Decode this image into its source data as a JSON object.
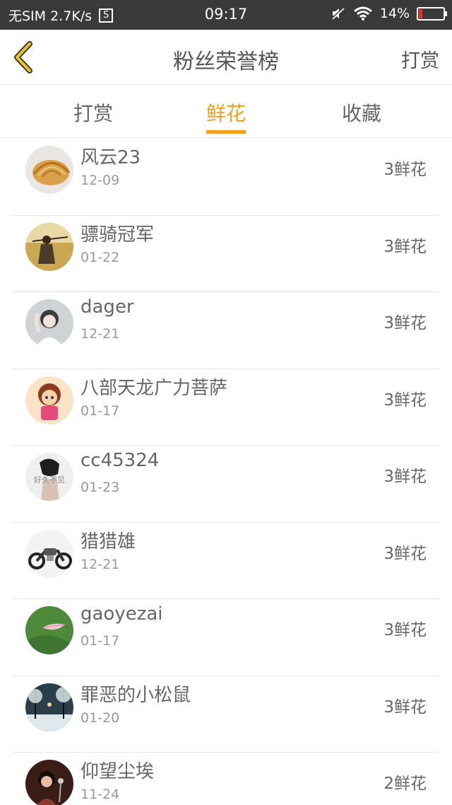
{
  "status_bar": {
    "carrier": "无SIM 2.7K/s",
    "sim_icon_text": "S",
    "time": "09:17",
    "battery": "14%",
    "battery_level": 0.14
  },
  "header": {
    "title": "粉丝荣誉榜",
    "action": "打赏"
  },
  "tabs": [
    {
      "label": "打赏"
    },
    {
      "label": "鲜花"
    },
    {
      "label": "收藏"
    }
  ],
  "active_tab": "鲜花",
  "fans": [
    {
      "name": "风云23",
      "date": "12-09",
      "amount": "3鲜花",
      "avatar": "shell"
    },
    {
      "name": "骠骑冠军",
      "date": "01-22",
      "amount": "3鲜花",
      "avatar": "field-person"
    },
    {
      "name": "dager",
      "date": "12-21",
      "amount": "3鲜花",
      "avatar": "girl"
    },
    {
      "name": "八部天龙广力菩萨",
      "date": "01-17",
      "amount": "3鲜花",
      "avatar": "cartoon"
    },
    {
      "name": "cc45324",
      "date": "01-23",
      "amount": "3鲜花",
      "avatar": "bw-person",
      "avatar_text": "好久不见"
    },
    {
      "name": "猎猎雄",
      "date": "12-21",
      "amount": "3鲜花",
      "avatar": "motorcycle"
    },
    {
      "name": "gaoyezai",
      "date": "01-17",
      "amount": "3鲜花",
      "avatar": "leaf"
    },
    {
      "name": "罪恶的小松鼠",
      "date": "01-20",
      "amount": "3鲜花",
      "avatar": "winter-street"
    },
    {
      "name": "仰望尘埃",
      "date": "11-24",
      "amount": "2鲜花",
      "avatar": "singer"
    }
  ],
  "colors": {
    "accent": "#f0a01c",
    "status_bar": "#3a3a3a",
    "battery_low": "#e8332d"
  }
}
